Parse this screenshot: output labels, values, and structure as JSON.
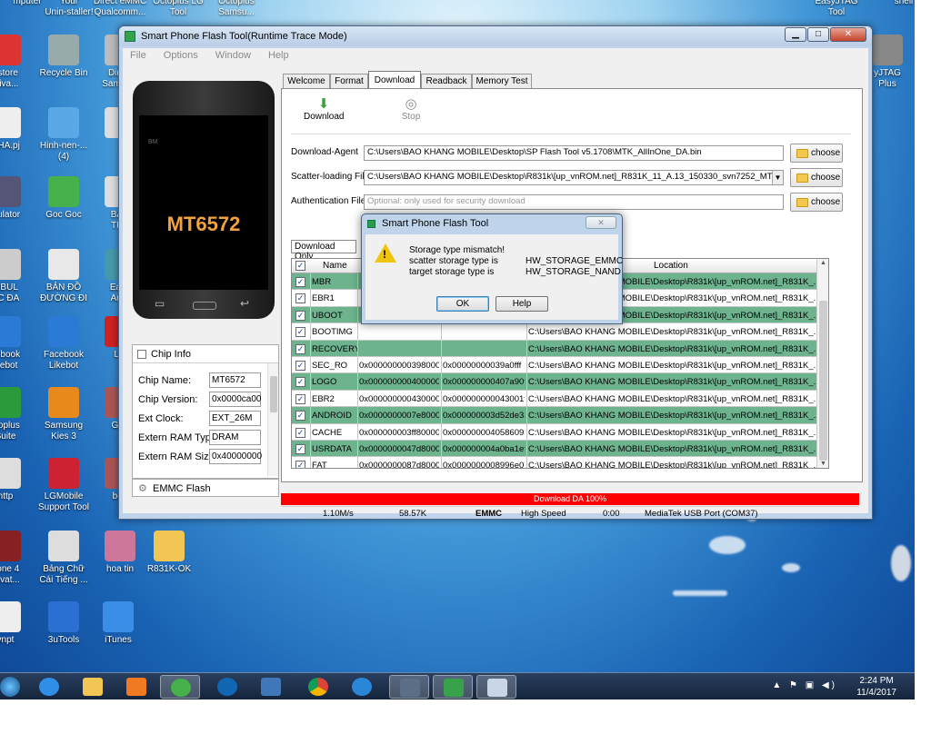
{
  "desktop": {
    "top_labels": [
      "mputer",
      "Your\nUnin-staller!",
      "Direct eMMC\nQualcomm...",
      "Octoplus LG\nTool",
      "Octoplus\nSamsu...",
      "EasyJTAG\nTool",
      "shell"
    ],
    "icons": [
      {
        "label": "estore\nctiva..."
      },
      {
        "label": "Recycle Bin"
      },
      {
        "label": "Direct\nSamsu..."
      },
      {
        "label": "NHA.pj"
      },
      {
        "label": "Hinh-nen-...\n(4)"
      },
      {
        "label": "i"
      },
      {
        "label": "lculator"
      },
      {
        "label": "Goc Goc"
      },
      {
        "label": "BẢN\nTHẢ"
      },
      {
        "label": "MBUL\nẠC ĐA"
      },
      {
        "label": "BẢN ĐỒ\nĐƯỜNG ĐI"
      },
      {
        "label": "Easy\nAndr"
      },
      {
        "label": "cebook\nikebot"
      },
      {
        "label": "Facebook\nLikebot"
      },
      {
        "label": "LG"
      },
      {
        "label": "ctoplus\nSuite"
      },
      {
        "label": "Samsung\nKies 3"
      },
      {
        "label": "Gon"
      },
      {
        "label": "http"
      },
      {
        "label": "LGMobile\nSupport Tool"
      },
      {
        "label": "bon"
      },
      {
        "label": "hone 4\nktivat..."
      },
      {
        "label": "Bảng Chữ\nCái Tiếng ..."
      },
      {
        "label": "hoa tin"
      },
      {
        "label": "R831K-OK"
      },
      {
        "label": "vnpt"
      },
      {
        "label": "3uTools"
      },
      {
        "label": "iTunes"
      },
      {
        "label": "yJTAG\nPlus"
      }
    ]
  },
  "taskbar": {
    "time": "2:24 PM",
    "date": "11/4/2017"
  },
  "window": {
    "title": "Smart Phone Flash Tool(Runtime Trace Mode)",
    "menu": [
      "File",
      "Options",
      "Window",
      "Help"
    ],
    "phone_model": "MT6572",
    "phone_brand": "BM",
    "chip_info": {
      "title": "Chip Info",
      "rows": [
        {
          "k": "Chip Name:",
          "v": "MT6572"
        },
        {
          "k": "Chip Version:",
          "v": "0x0000ca00"
        },
        {
          "k": "Ext Clock:",
          "v": "EXT_26M"
        },
        {
          "k": "Extern RAM Type:",
          "v": "DRAM"
        },
        {
          "k": "Extern RAM Size:",
          "v": "0x40000000"
        }
      ]
    },
    "emmc_flash": "EMMC Flash",
    "tabs": [
      "Welcome",
      "Format",
      "Download",
      "Readback",
      "Memory Test"
    ],
    "toolbar": {
      "download": "Download",
      "stop": "Stop"
    },
    "fields": {
      "download_agent": {
        "label": "Download-Agent",
        "value": "C:\\Users\\BAO KHANG MOBILE\\Desktop\\SP Flash Tool v5.1708\\MTK_AllInOne_DA.bin"
      },
      "scatter": {
        "label": "Scatter-loading File",
        "value": "C:\\Users\\BAO KHANG MOBILE\\Desktop\\R831k\\[up_vnROM.net]_R831K_11_A.13_150330_svn7252_MT6572_FL\\MT6572"
      },
      "auth": {
        "label": "Authentication File",
        "placeholder": "Optional: only used for security download"
      },
      "choose": "choose"
    },
    "download_mode": "Download Only",
    "table": {
      "headers": {
        "name": "Name",
        "location": "Location"
      },
      "rows": [
        {
          "name": "MBR",
          "begin": "",
          "end": "",
          "loc": "C:\\Users\\BAO KHANG MOBILE\\Desktop\\R831k\\[up_vnROM.net]_R831K_...",
          "green": true
        },
        {
          "name": "EBR1",
          "begin": "",
          "end": "",
          "loc": "C:\\Users\\BAO KHANG MOBILE\\Desktop\\R831k\\[up_vnROM.net]_R831K_...",
          "green": false
        },
        {
          "name": "UBOOT",
          "begin": "",
          "end": "",
          "loc": "C:\\Users\\BAO KHANG MOBILE\\Desktop\\R831k\\[up_vnROM.net]_R831K_...",
          "green": true
        },
        {
          "name": "BOOTIMG",
          "begin": "",
          "end": "",
          "loc": "C:\\Users\\BAO KHANG MOBILE\\Desktop\\R831k\\[up_vnROM.net]_R831K_...",
          "green": false
        },
        {
          "name": "RECOVERY",
          "begin": "",
          "end": "",
          "loc": "C:\\Users\\BAO KHANG MOBILE\\Desktop\\R831k\\[up_vnROM.net]_R831K_...",
          "green": true
        },
        {
          "name": "SEC_RO",
          "begin": "0x0000000003980000",
          "end": "0x00000000039a0fff",
          "loc": "C:\\Users\\BAO KHANG MOBILE\\Desktop\\R831k\\[up_vnROM.net]_R831K_...",
          "green": false
        },
        {
          "name": "LOGO",
          "begin": "0x0000000004000000",
          "end": "0x000000000407a90f",
          "loc": "C:\\Users\\BAO KHANG MOBILE\\Desktop\\R831k\\[up_vnROM.net]_R831K_...",
          "green": true
        },
        {
          "name": "EBR2",
          "begin": "0x0000000004300000",
          "end": "0x000000000043001ff",
          "loc": "C:\\Users\\BAO KHANG MOBILE\\Desktop\\R831k\\[up_vnROM.net]_R831K_...",
          "green": false
        },
        {
          "name": "ANDROID",
          "begin": "0x0000000007e80000",
          "end": "0x000000003d52de33",
          "loc": "C:\\Users\\BAO KHANG MOBILE\\Desktop\\R831k\\[up_vnROM.net]_R831K_...",
          "green": true
        },
        {
          "name": "CACHE",
          "begin": "0x000000003ff80000",
          "end": "0x0000000040586093",
          "loc": "C:\\Users\\BAO KHANG MOBILE\\Desktop\\R831k\\[up_vnROM.net]_R831K_...",
          "green": false
        },
        {
          "name": "USRDATA",
          "begin": "0x0000000047d80000",
          "end": "0x000000004a0ba1ef",
          "loc": "C:\\Users\\BAO KHANG MOBILE\\Desktop\\R831k\\[up_vnROM.net]_R831K_...",
          "green": true
        },
        {
          "name": "FAT",
          "begin": "0x0000000087d80000",
          "end": "0x0000000008996e07b",
          "loc": "C:\\Users\\BAO KHANG MOBILE\\Desktop\\R831k\\[up_vnROM.net]_R831K_...",
          "green": false
        }
      ]
    },
    "progress": {
      "label": "Download DA 100%",
      "value": 1.0,
      "color": "#ff0000"
    },
    "status": {
      "speed": "1.10M/s",
      "size": "58.57K",
      "storage": "EMMC",
      "usb_speed": "High Speed",
      "time": "0:00",
      "port": "MediaTek USB Port (COM37)"
    }
  },
  "dialog": {
    "title": "Smart Phone Flash Tool",
    "heading": "Storage type mismatch!",
    "line1_k": "scatter storage type is",
    "line1_v": "HW_STORAGE_EMMC",
    "line2_k": "target storage type is",
    "line2_v": "HW_STORAGE_NAND",
    "ok": "OK",
    "help": "Help"
  },
  "colors": {
    "row_green": "#6cb38e",
    "progress": "#ff0000",
    "title_blue": "#bfd3ea"
  }
}
